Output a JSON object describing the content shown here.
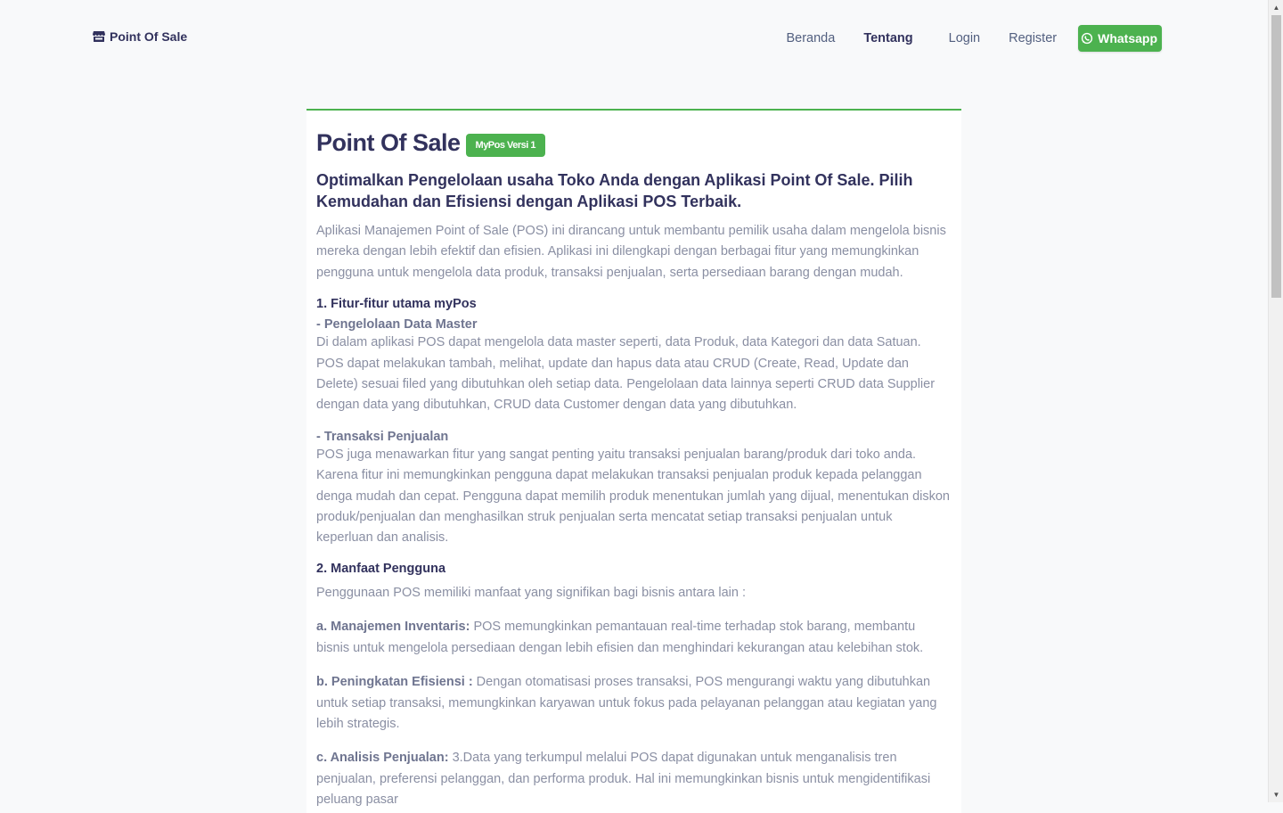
{
  "navbar": {
    "brand_label": "Point Of Sale",
    "brand_icon": "store-icon",
    "links": [
      {
        "label": "Beranda"
      },
      {
        "label": "Tentang",
        "active": true
      },
      {
        "label": "Login"
      },
      {
        "label": "Register"
      }
    ],
    "whatsapp_label": "Whatsapp",
    "whatsapp_icon": "whatsapp-icon",
    "accent_color": "#4cb24f"
  },
  "main": {
    "title": "Point Of Sale",
    "badge": "MyPos Versi 1",
    "subtitle": "Optimalkan Pengelolaan usaha Toko Anda dengan Aplikasi Point Of Sale. Pilih Kemudahan dan Efisiensi dengan Aplikasi POS Terbaik.",
    "intro": "Aplikasi Manajemen Point of Sale (POS) ini dirancang untuk membantu pemilik usaha dalam mengelola bisnis mereka dengan lebih efektif dan efisien. Aplikasi ini dilengkapi dengan berbagai fitur yang memungkinkan pengguna untuk mengelola data produk, transaksi penjualan, serta persediaan barang dengan mudah.",
    "section1": {
      "heading": "1. Fitur-fitur utama myPos",
      "features": [
        {
          "heading": "- Pengelolaan Data Master",
          "text": "Di dalam aplikasi POS dapat mengelola data master seperti, data Produk, data Kategori dan data Satuan. POS dapat melakukan tambah, melihat, update dan hapus data atau CRUD (Create, Read, Update dan Delete) sesuai filed yang dibutuhkan oleh setiap data. Pengelolaan data lainnya seperti CRUD data Supplier dengan data yang dibutuhkan, CRUD data Customer dengan data yang dibutuhkan."
        },
        {
          "heading": "- Transaksi Penjualan",
          "text": "POS juga menawarkan fitur yang sangat penting yaitu transaksi penjualan barang/produk dari toko anda. Karena fitur ini memungkinkan pengguna dapat melakukan transaksi penjualan produk kepada pelanggan denga mudah dan cepat. Pengguna dapat memilih produk menentukan jumlah yang dijual, menentukan diskon produk/penjualan dan menghasilkan struk penjualan serta mencatat setiap transaksi penjualan untuk keperluan dan analisis."
        }
      ]
    },
    "section2": {
      "heading": "2. Manfaat Pengguna",
      "intro": "Penggunaan POS memiliki manfaat yang signifikan bagi bisnis antara lain :",
      "benefits": [
        {
          "label": "a. Manajemen Inventaris:",
          "text": " POS memungkinkan pemantauan real-time terhadap stok barang, membantu bisnis untuk mengelola persediaan dengan lebih efisien dan menghindari kekurangan atau kelebihan stok."
        },
        {
          "label": "b. Peningkatan Efisiensi :",
          "text": " Dengan otomatisasi proses transaksi, POS mengurangi waktu yang dibutuhkan untuk setiap transaksi, memungkinkan karyawan untuk fokus pada pelayanan pelanggan atau kegiatan yang lebih strategis."
        },
        {
          "label": "c. Analisis Penjualan:",
          "text": " 3.Data yang terkumpul melalui POS dapat digunakan untuk menganalisis tren penjualan, preferensi pelanggan, dan performa produk. Hal ini memungkinkan bisnis untuk mengidentifikasi peluang pasar"
        }
      ]
    }
  },
  "scrollbar": {
    "up_icon": "scroll-up-arrow-icon",
    "down_icon": "scroll-down-arrow-icon"
  }
}
